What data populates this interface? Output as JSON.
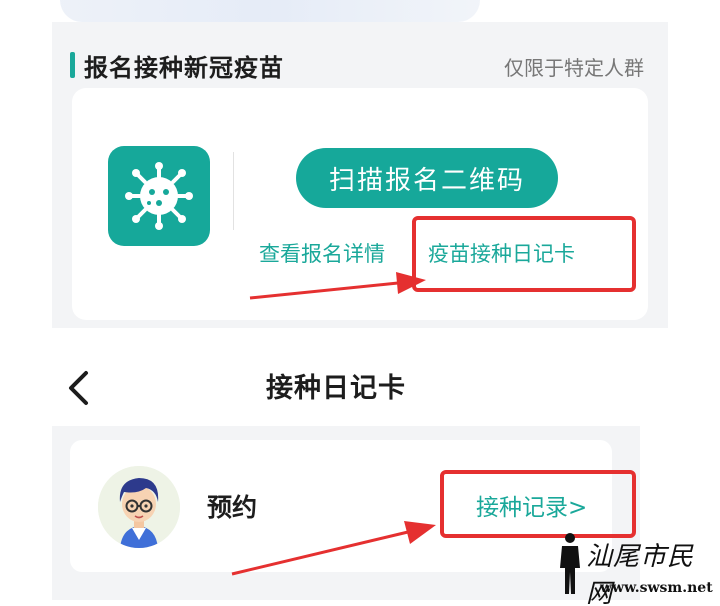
{
  "registration": {
    "title": "报名接种新冠疫苗",
    "note": "仅限于特定人群",
    "scan_button": "扫描报名二维码",
    "link_details": "查看报名详情",
    "link_diary": "疫苗接种日记卡"
  },
  "diary_page": {
    "title": "接种日记卡",
    "appointment_label": "预约",
    "record_link": "接种记录>"
  },
  "watermark": {
    "name": "汕尾市民网",
    "url": "www.swsm.net"
  },
  "colors": {
    "accent": "#16a89a",
    "highlight": "#e53030",
    "background": "#f3f4f6"
  },
  "icons": [
    "virus-icon",
    "back-arrow-icon",
    "avatar-boy-icon"
  ]
}
